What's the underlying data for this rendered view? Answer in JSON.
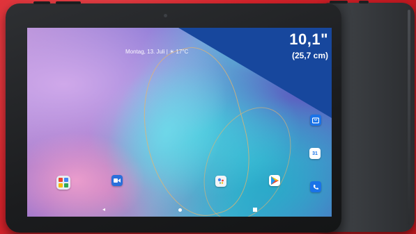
{
  "product_badge": {
    "size_inches": "10,1\"",
    "size_cm": "(25,7 cm)",
    "badge_color": "#17479d"
  },
  "status_bar": {
    "datetime": "Montag, 13. Juli | ☀ 17°C"
  },
  "home_screen": {
    "dock_icons": [
      "folder-icon",
      "video-camera-icon",
      "google-assistant-icon",
      "play-store-icon"
    ],
    "side_icons": [
      "store-icon",
      "calendar-icon",
      "phone-icon"
    ],
    "calendar_day": "31"
  },
  "colors": {
    "background_red": "#d8242c",
    "tablet_bezel": "#1b1c1e",
    "wallpaper_cyan": "#3fb9d6",
    "wallpaper_purple": "#b58fd6"
  }
}
